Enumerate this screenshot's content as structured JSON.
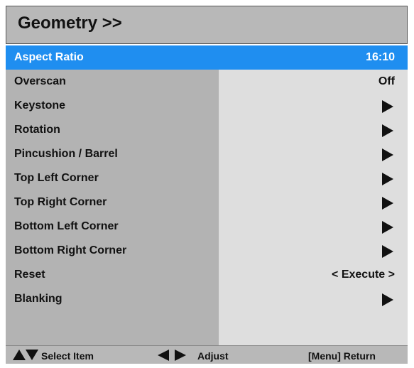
{
  "header": {
    "title": "Geometry >>"
  },
  "menu": {
    "items": [
      {
        "label": "Aspect Ratio",
        "value": "16:10",
        "selected": true
      },
      {
        "label": "Overscan",
        "value": "Off"
      },
      {
        "label": "Keystone",
        "icon": "submenu-arrow-icon"
      },
      {
        "label": "Rotation",
        "icon": "submenu-arrow-icon"
      },
      {
        "label": "Pincushion / Barrel",
        "icon": "submenu-arrow-icon"
      },
      {
        "label": "Top Left Corner",
        "icon": "submenu-arrow-icon"
      },
      {
        "label": "Top Right Corner",
        "icon": "submenu-arrow-icon"
      },
      {
        "label": "Bottom Left Corner",
        "icon": "submenu-arrow-icon"
      },
      {
        "label": "Bottom Right Corner",
        "icon": "submenu-arrow-icon"
      },
      {
        "label": "Reset",
        "value": "< Execute >"
      },
      {
        "label": "Blanking",
        "icon": "submenu-arrow-icon"
      }
    ]
  },
  "footer": {
    "select_label": "Select Item",
    "adjust_label": "Adjust",
    "return_label": "[Menu] Return"
  },
  "colors": {
    "selected": "#1f8ef0",
    "left_panel": "#b3b3b3",
    "right_panel": "#dedede",
    "title_bar": "#b8b8b8"
  }
}
